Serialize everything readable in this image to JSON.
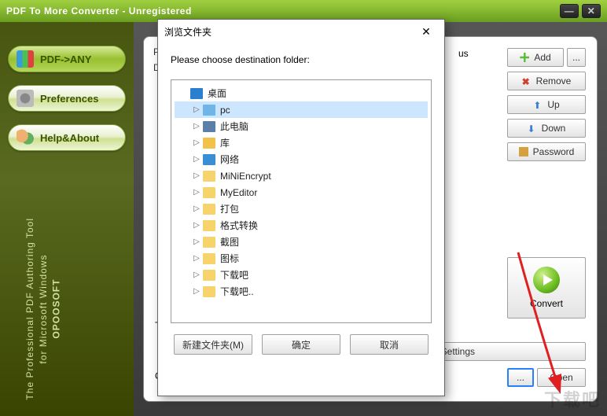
{
  "titlebar": {
    "title": "PDF To More Converter - Unregistered"
  },
  "nav": {
    "pdf_any": "PDF->ANY",
    "preferences": "Preferences",
    "help_about": "Help&About"
  },
  "sidebar_tag": {
    "brand": "OPOOSOFT",
    "line1": "The Professional PDF Authoring Tool",
    "line2": "for Microsoft Windows"
  },
  "main": {
    "col_pl": "Pl",
    "col_d": "D",
    "col_us": "us",
    "row_t": "T",
    "row_c": "C"
  },
  "buttons": {
    "add": "Add",
    "more": "...",
    "remove": "Remove",
    "up": "Up",
    "down": "Down",
    "password": "Password",
    "convert": "Convert",
    "image_settings": "Image Settings",
    "open": "Open",
    "ellipsis": "..."
  },
  "dialog": {
    "title": "浏览文件夹",
    "message": "Please choose destination folder:",
    "root": "桌面",
    "items": [
      {
        "label": "pc",
        "icon": "#6fb6e8",
        "selected": true
      },
      {
        "label": "此电脑",
        "icon": "#5a7fa8"
      },
      {
        "label": "库",
        "icon": "#f0c24a"
      },
      {
        "label": "网络",
        "icon": "#3a8fd4"
      },
      {
        "label": "MiNiEncrypt",
        "icon": "#f6d36b"
      },
      {
        "label": "MyEditor",
        "icon": "#f6d36b"
      },
      {
        "label": "打包",
        "icon": "#f6d36b"
      },
      {
        "label": "格式转换",
        "icon": "#f6d36b"
      },
      {
        "label": "截图",
        "icon": "#f6d36b"
      },
      {
        "label": "图标",
        "icon": "#f6d36b"
      },
      {
        "label": "下载吧",
        "icon": "#f6d36b"
      },
      {
        "label": "下载吧..",
        "icon": "#f6d36b"
      }
    ],
    "new_folder": "新建文件夹(M)",
    "ok": "确定",
    "cancel": "取消"
  },
  "watermark": "下载吧"
}
